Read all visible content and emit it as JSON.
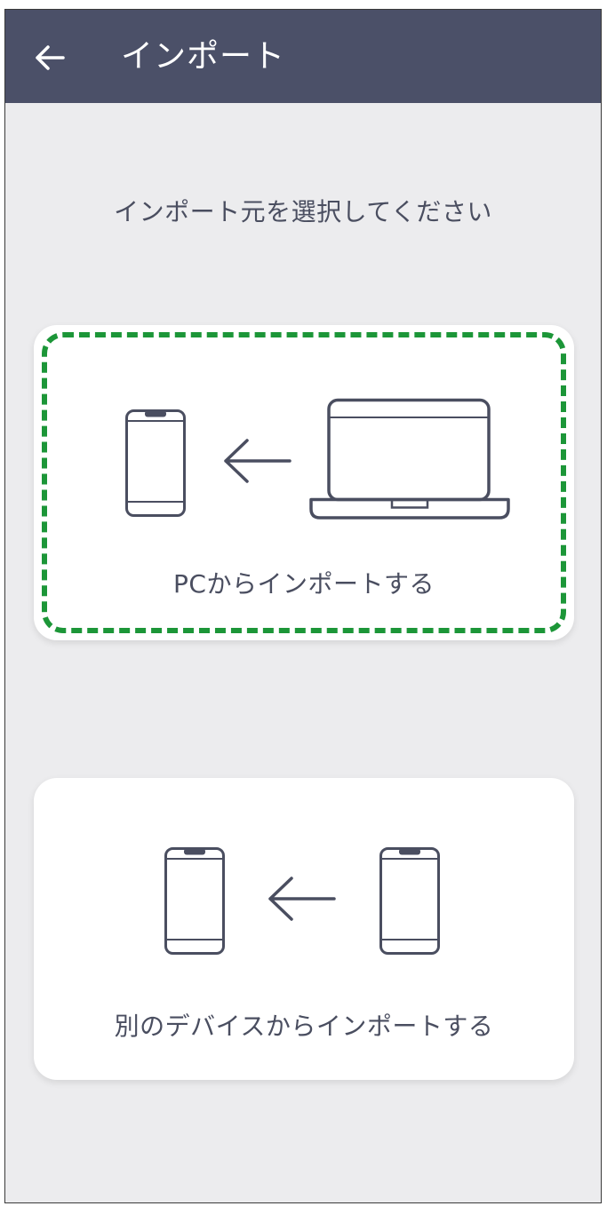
{
  "appbar": {
    "back_icon": "arrow-left-icon",
    "title": "インポート"
  },
  "prompt": "インポート元を選択してください",
  "options": [
    {
      "label": "PCからインポートする",
      "icons": [
        "smartphone-icon",
        "arrow-left-icon",
        "laptop-icon"
      ],
      "highlighted": true
    },
    {
      "label": "別のデバイスからインポートする",
      "icons": [
        "smartphone-icon",
        "arrow-left-icon",
        "smartphone-icon"
      ],
      "highlighted": false
    }
  ],
  "colors": {
    "appbar": "#4B5068",
    "background": "#ECECEE",
    "icon_stroke": "#4A4E60",
    "highlight": "#1C9638"
  }
}
